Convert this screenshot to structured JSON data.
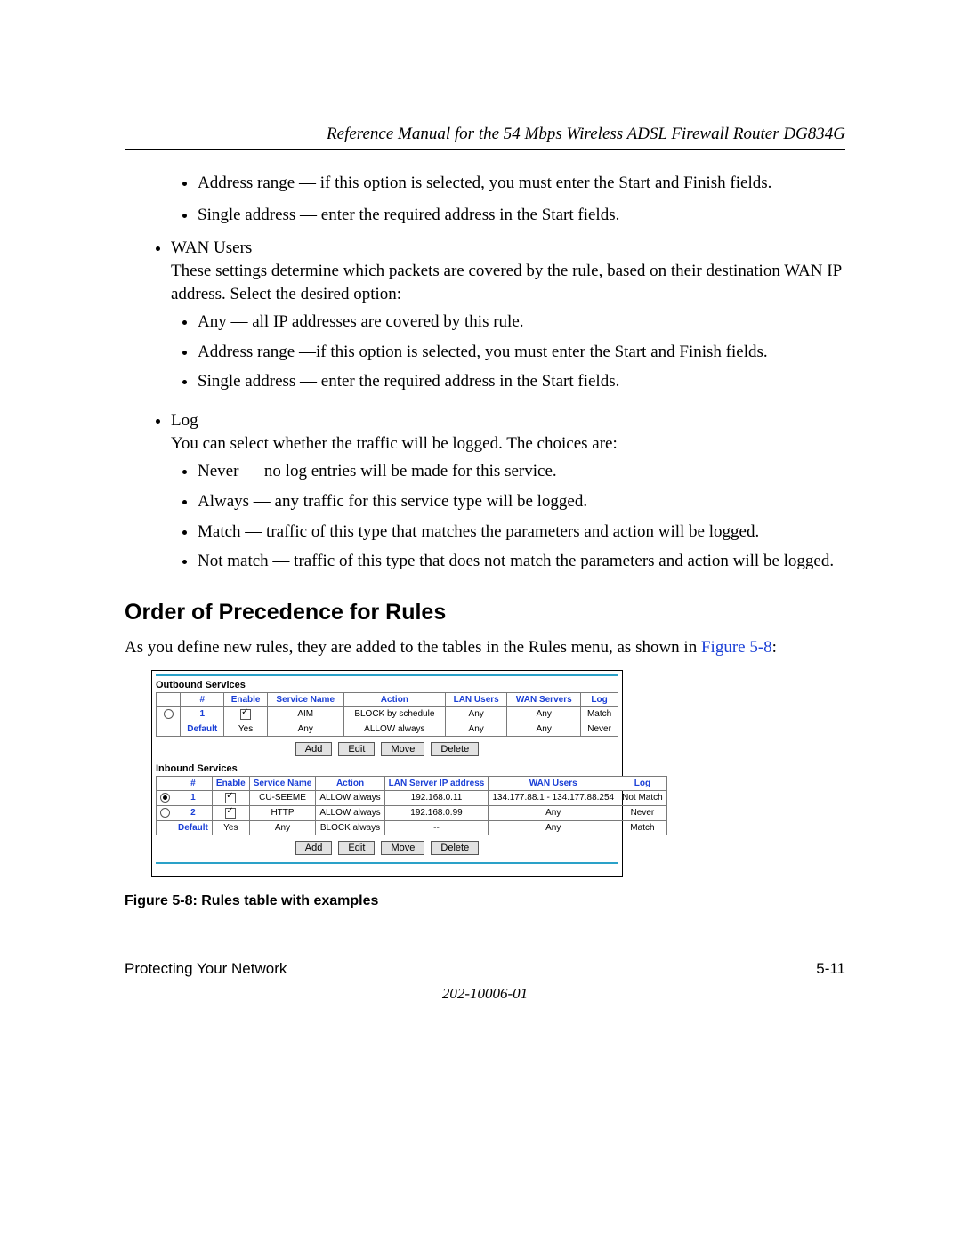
{
  "header": {
    "running_head": "Reference Manual for the 54 Mbps Wireless ADSL Firewall Router DG834G"
  },
  "content": {
    "sub_bullets_top": [
      "Address range — if this option is selected, you must enter the Start and Finish fields.",
      "Single address — enter the required address in the Start fields."
    ],
    "wan_users": {
      "title": "WAN Users",
      "desc": "These settings determine which packets are covered by the rule, based on their destination WAN IP address. Select the desired option:",
      "items": [
        "Any — all IP addresses are covered by this rule.",
        "Address range —if this option is selected, you must enter the Start and Finish fields.",
        "Single address — enter the required address in the Start fields."
      ]
    },
    "log": {
      "title": "Log",
      "desc": "You can select whether the traffic will be logged. The choices are:",
      "items": [
        "Never — no log entries will be made for this service.",
        "Always — any traffic for this service type will be logged.",
        "Match — traffic of this type that matches the parameters and action will be logged.",
        "Not match — traffic of this type that does not match the parameters and action will be logged."
      ]
    },
    "section_heading": "Order of Precedence for Rules",
    "section_para_pre": "As you define new rules, they are added to the tables in the Rules menu, as shown in ",
    "figure_ref": "Figure 5-8",
    "section_para_post": ":",
    "figure_caption": "Figure 5-8:  Rules table with examples"
  },
  "figure": {
    "outbound": {
      "title": "Outbound Services",
      "headers": [
        "",
        "#",
        "Enable",
        "Service Name",
        "Action",
        "LAN Users",
        "WAN Servers",
        "Log"
      ],
      "rows": [
        {
          "radio": "off",
          "idx": "1",
          "enable": "on",
          "service": "AIM",
          "action": "BLOCK by schedule",
          "lan": "Any",
          "wan": "Any",
          "log": "Match"
        },
        {
          "radio": "",
          "idx": "Default",
          "enable": "Yes",
          "service": "Any",
          "action": "ALLOW always",
          "lan": "Any",
          "wan": "Any",
          "log": "Never"
        }
      ]
    },
    "inbound": {
      "title": "Inbound Services",
      "headers": [
        "",
        "#",
        "Enable",
        "Service Name",
        "Action",
        "LAN Server IP address",
        "WAN Users",
        "Log"
      ],
      "rows": [
        {
          "radio": "on",
          "idx": "1",
          "enable": "on",
          "service": "CU-SEEME",
          "action": "ALLOW always",
          "lanip": "192.168.0.11",
          "wan": "134.177.88.1 - 134.177.88.254",
          "log": "Not Match"
        },
        {
          "radio": "off",
          "idx": "2",
          "enable": "on",
          "service": "HTTP",
          "action": "ALLOW always",
          "lanip": "192.168.0.99",
          "wan": "Any",
          "log": "Never"
        },
        {
          "radio": "",
          "idx": "Default",
          "enable": "Yes",
          "service": "Any",
          "action": "BLOCK always",
          "lanip": "--",
          "wan": "Any",
          "log": "Match"
        }
      ]
    },
    "buttons": [
      "Add",
      "Edit",
      "Move",
      "Delete"
    ]
  },
  "footer": {
    "left": "Protecting Your Network",
    "right": "5-11",
    "docnum": "202-10006-01"
  }
}
